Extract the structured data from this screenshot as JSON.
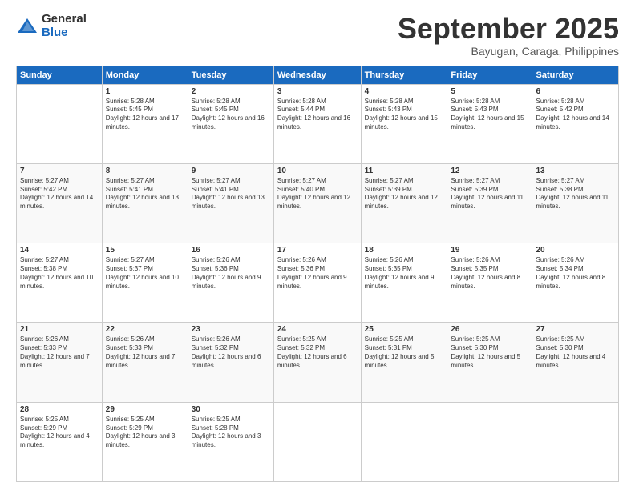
{
  "logo": {
    "general": "General",
    "blue": "Blue"
  },
  "header": {
    "month": "September 2025",
    "location": "Bayugan, Caraga, Philippines"
  },
  "days": [
    "Sunday",
    "Monday",
    "Tuesday",
    "Wednesday",
    "Thursday",
    "Friday",
    "Saturday"
  ],
  "weeks": [
    [
      {
        "day": "",
        "sunrise": "",
        "sunset": "",
        "daylight": ""
      },
      {
        "day": "1",
        "sunrise": "Sunrise: 5:28 AM",
        "sunset": "Sunset: 5:45 PM",
        "daylight": "Daylight: 12 hours and 17 minutes."
      },
      {
        "day": "2",
        "sunrise": "Sunrise: 5:28 AM",
        "sunset": "Sunset: 5:45 PM",
        "daylight": "Daylight: 12 hours and 16 minutes."
      },
      {
        "day": "3",
        "sunrise": "Sunrise: 5:28 AM",
        "sunset": "Sunset: 5:44 PM",
        "daylight": "Daylight: 12 hours and 16 minutes."
      },
      {
        "day": "4",
        "sunrise": "Sunrise: 5:28 AM",
        "sunset": "Sunset: 5:43 PM",
        "daylight": "Daylight: 12 hours and 15 minutes."
      },
      {
        "day": "5",
        "sunrise": "Sunrise: 5:28 AM",
        "sunset": "Sunset: 5:43 PM",
        "daylight": "Daylight: 12 hours and 15 minutes."
      },
      {
        "day": "6",
        "sunrise": "Sunrise: 5:28 AM",
        "sunset": "Sunset: 5:42 PM",
        "daylight": "Daylight: 12 hours and 14 minutes."
      }
    ],
    [
      {
        "day": "7",
        "sunrise": "Sunrise: 5:27 AM",
        "sunset": "Sunset: 5:42 PM",
        "daylight": "Daylight: 12 hours and 14 minutes."
      },
      {
        "day": "8",
        "sunrise": "Sunrise: 5:27 AM",
        "sunset": "Sunset: 5:41 PM",
        "daylight": "Daylight: 12 hours and 13 minutes."
      },
      {
        "day": "9",
        "sunrise": "Sunrise: 5:27 AM",
        "sunset": "Sunset: 5:41 PM",
        "daylight": "Daylight: 12 hours and 13 minutes."
      },
      {
        "day": "10",
        "sunrise": "Sunrise: 5:27 AM",
        "sunset": "Sunset: 5:40 PM",
        "daylight": "Daylight: 12 hours and 12 minutes."
      },
      {
        "day": "11",
        "sunrise": "Sunrise: 5:27 AM",
        "sunset": "Sunset: 5:39 PM",
        "daylight": "Daylight: 12 hours and 12 minutes."
      },
      {
        "day": "12",
        "sunrise": "Sunrise: 5:27 AM",
        "sunset": "Sunset: 5:39 PM",
        "daylight": "Daylight: 12 hours and 11 minutes."
      },
      {
        "day": "13",
        "sunrise": "Sunrise: 5:27 AM",
        "sunset": "Sunset: 5:38 PM",
        "daylight": "Daylight: 12 hours and 11 minutes."
      }
    ],
    [
      {
        "day": "14",
        "sunrise": "Sunrise: 5:27 AM",
        "sunset": "Sunset: 5:38 PM",
        "daylight": "Daylight: 12 hours and 10 minutes."
      },
      {
        "day": "15",
        "sunrise": "Sunrise: 5:27 AM",
        "sunset": "Sunset: 5:37 PM",
        "daylight": "Daylight: 12 hours and 10 minutes."
      },
      {
        "day": "16",
        "sunrise": "Sunrise: 5:26 AM",
        "sunset": "Sunset: 5:36 PM",
        "daylight": "Daylight: 12 hours and 9 minutes."
      },
      {
        "day": "17",
        "sunrise": "Sunrise: 5:26 AM",
        "sunset": "Sunset: 5:36 PM",
        "daylight": "Daylight: 12 hours and 9 minutes."
      },
      {
        "day": "18",
        "sunrise": "Sunrise: 5:26 AM",
        "sunset": "Sunset: 5:35 PM",
        "daylight": "Daylight: 12 hours and 9 minutes."
      },
      {
        "day": "19",
        "sunrise": "Sunrise: 5:26 AM",
        "sunset": "Sunset: 5:35 PM",
        "daylight": "Daylight: 12 hours and 8 minutes."
      },
      {
        "day": "20",
        "sunrise": "Sunrise: 5:26 AM",
        "sunset": "Sunset: 5:34 PM",
        "daylight": "Daylight: 12 hours and 8 minutes."
      }
    ],
    [
      {
        "day": "21",
        "sunrise": "Sunrise: 5:26 AM",
        "sunset": "Sunset: 5:33 PM",
        "daylight": "Daylight: 12 hours and 7 minutes."
      },
      {
        "day": "22",
        "sunrise": "Sunrise: 5:26 AM",
        "sunset": "Sunset: 5:33 PM",
        "daylight": "Daylight: 12 hours and 7 minutes."
      },
      {
        "day": "23",
        "sunrise": "Sunrise: 5:26 AM",
        "sunset": "Sunset: 5:32 PM",
        "daylight": "Daylight: 12 hours and 6 minutes."
      },
      {
        "day": "24",
        "sunrise": "Sunrise: 5:25 AM",
        "sunset": "Sunset: 5:32 PM",
        "daylight": "Daylight: 12 hours and 6 minutes."
      },
      {
        "day": "25",
        "sunrise": "Sunrise: 5:25 AM",
        "sunset": "Sunset: 5:31 PM",
        "daylight": "Daylight: 12 hours and 5 minutes."
      },
      {
        "day": "26",
        "sunrise": "Sunrise: 5:25 AM",
        "sunset": "Sunset: 5:30 PM",
        "daylight": "Daylight: 12 hours and 5 minutes."
      },
      {
        "day": "27",
        "sunrise": "Sunrise: 5:25 AM",
        "sunset": "Sunset: 5:30 PM",
        "daylight": "Daylight: 12 hours and 4 minutes."
      }
    ],
    [
      {
        "day": "28",
        "sunrise": "Sunrise: 5:25 AM",
        "sunset": "Sunset: 5:29 PM",
        "daylight": "Daylight: 12 hours and 4 minutes."
      },
      {
        "day": "29",
        "sunrise": "Sunrise: 5:25 AM",
        "sunset": "Sunset: 5:29 PM",
        "daylight": "Daylight: 12 hours and 3 minutes."
      },
      {
        "day": "30",
        "sunrise": "Sunrise: 5:25 AM",
        "sunset": "Sunset: 5:28 PM",
        "daylight": "Daylight: 12 hours and 3 minutes."
      },
      {
        "day": "",
        "sunrise": "",
        "sunset": "",
        "daylight": ""
      },
      {
        "day": "",
        "sunrise": "",
        "sunset": "",
        "daylight": ""
      },
      {
        "day": "",
        "sunrise": "",
        "sunset": "",
        "daylight": ""
      },
      {
        "day": "",
        "sunrise": "",
        "sunset": "",
        "daylight": ""
      }
    ]
  ]
}
